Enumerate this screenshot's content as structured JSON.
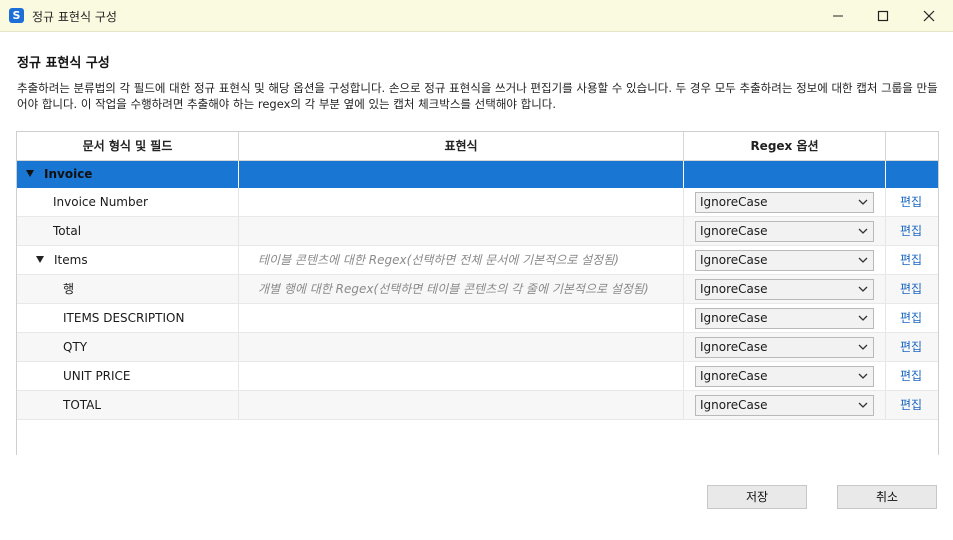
{
  "window": {
    "title": "정규 표현식 구성"
  },
  "page": {
    "heading": "정규 표현식 구성",
    "description": "추출하려는 분류법의 각 필드에 대한 정규 표현식 및 해당 옵션을 구성합니다. 손으로 정규 표현식을 쓰거나 편집기를 사용할 수 있습니다. 두 경우 모두 추출하려는 정보에 대한 캡처 그룹을 만들어야 합니다. 이 작업을 수행하려면 추출해야 하는 regex의 각 부분 옆에 있는 캡처 체크박스를 선택해야 합니다."
  },
  "table": {
    "headers": {
      "fields": "문서 형식 및 필드",
      "expression": "표현식",
      "options": "Regex 옵션"
    },
    "group_row": {
      "label": "Invoice"
    },
    "rows": [
      {
        "label": "Invoice Number",
        "expression": "",
        "option": "IgnoreCase",
        "edit": "편집"
      },
      {
        "label": "Total",
        "expression": "",
        "option": "IgnoreCase",
        "edit": "편집"
      },
      {
        "label": "Items",
        "expression": "테이블 콘텐츠에 대한 Regex(선택하면 전체 문서에 기본적으로 설정됨)",
        "option": "IgnoreCase",
        "edit": "편집"
      },
      {
        "label": "행",
        "expression": "개별 행에 대한 Regex(선택하면 테이블 콘텐츠의 각 줄에 기본적으로 설정됨)",
        "option": "IgnoreCase",
        "edit": "편집"
      },
      {
        "label": "ITEMS DESCRIPTION",
        "expression": "",
        "option": "IgnoreCase",
        "edit": "편집"
      },
      {
        "label": "QTY",
        "expression": "",
        "option": "IgnoreCase",
        "edit": "편집"
      },
      {
        "label": "UNIT PRICE",
        "expression": "",
        "option": "IgnoreCase",
        "edit": "편집"
      },
      {
        "label": "TOTAL",
        "expression": "",
        "option": "IgnoreCase",
        "edit": "편집"
      }
    ]
  },
  "buttons": {
    "save": "저장",
    "cancel": "취소"
  },
  "colors": {
    "selection": "#1976d2",
    "title_bar": "#fafae0",
    "link": "#1a66c2"
  },
  "icons": [
    "app-icon",
    "minimize-icon",
    "maximize-icon",
    "close-icon",
    "expand-triangle-icon",
    "chevron-down-icon"
  ]
}
